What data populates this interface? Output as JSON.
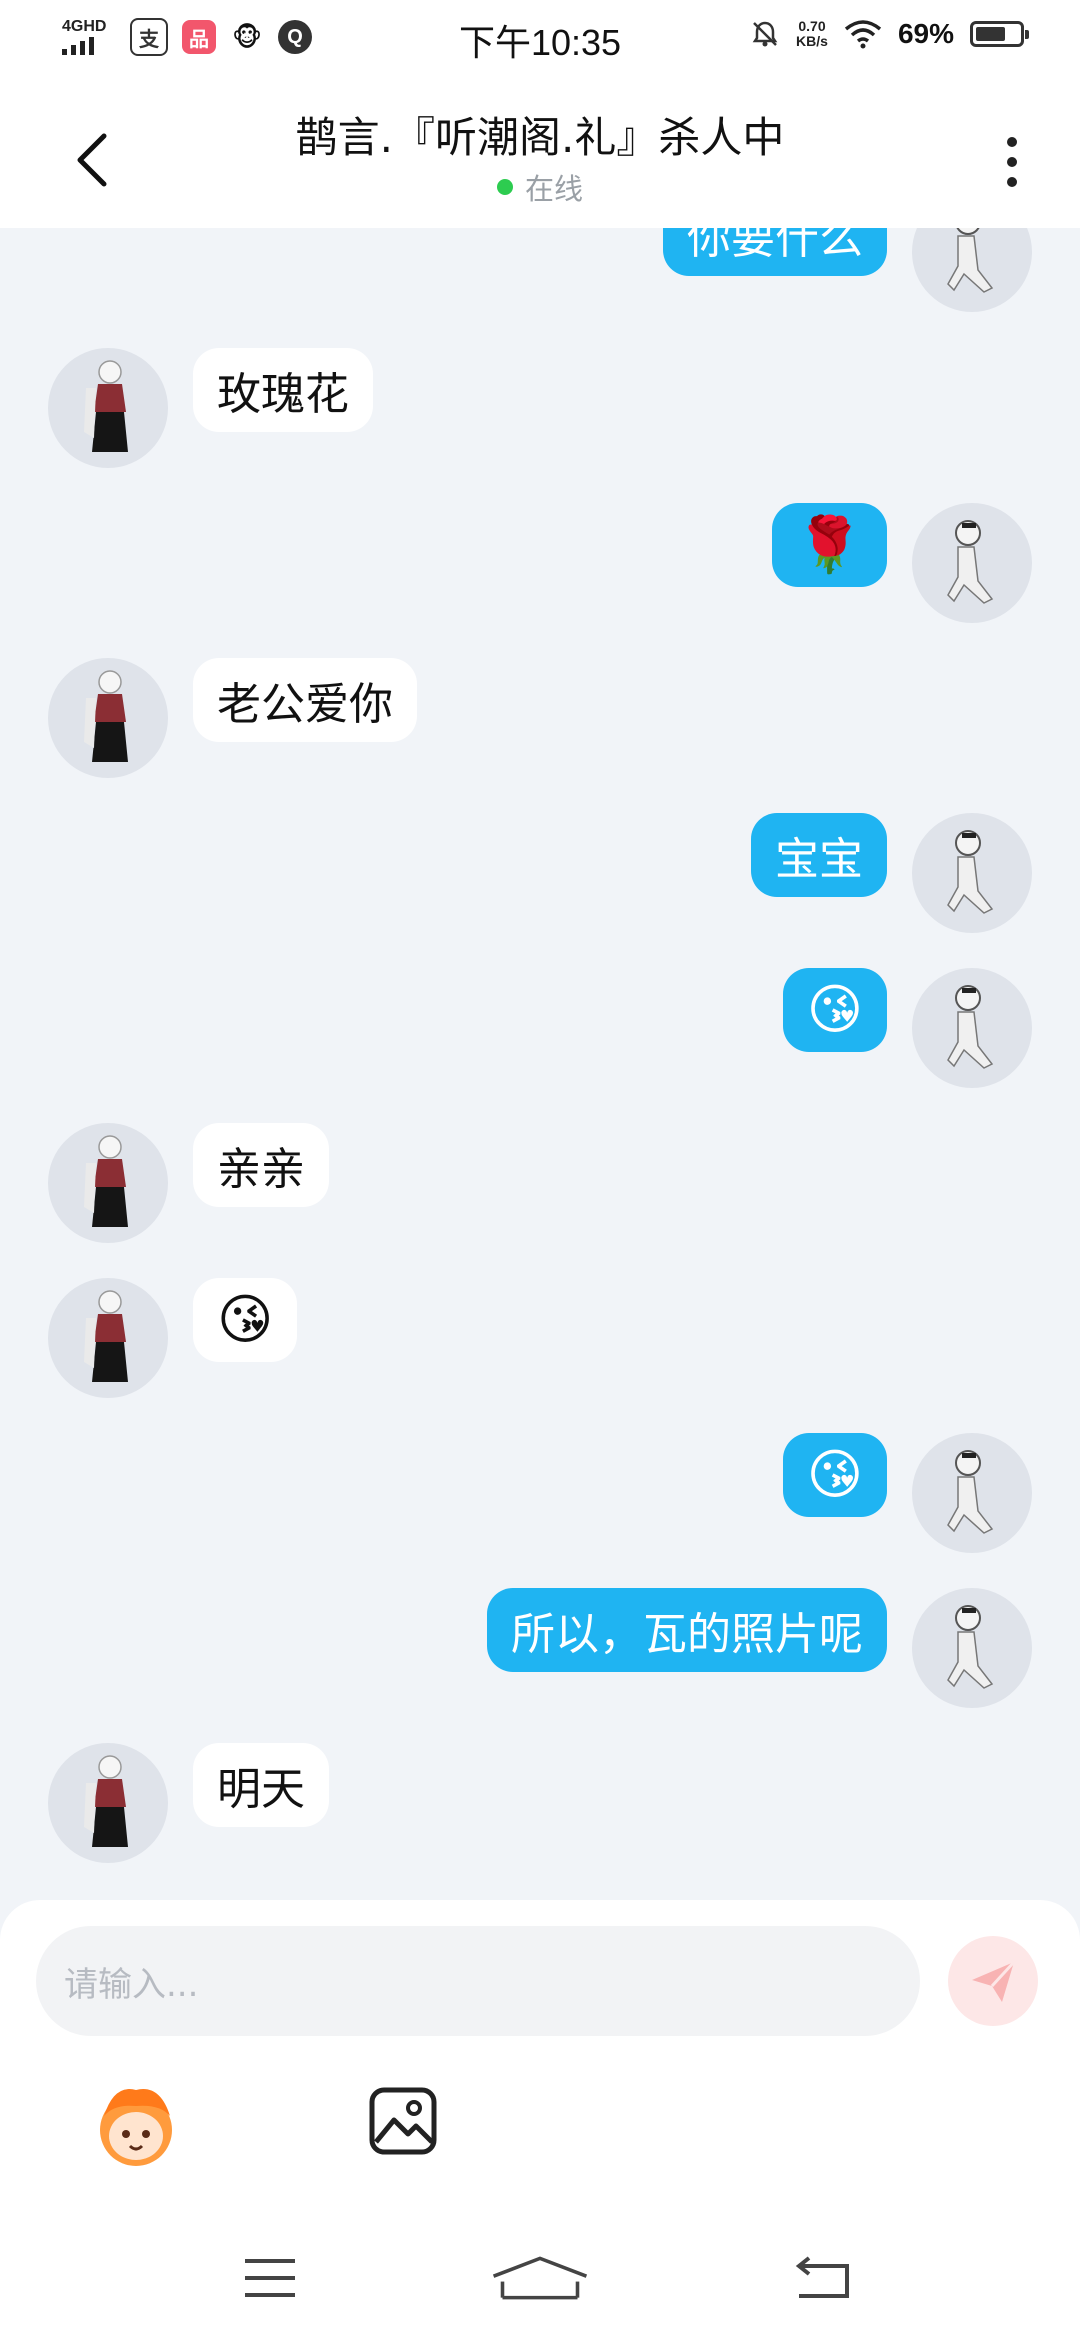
{
  "status_bar": {
    "network": "4GHD",
    "app_icons": [
      "支",
      "品",
      "🐵",
      "Q"
    ],
    "time": "下午10:35",
    "speed_value": "0.70",
    "speed_unit": "KB/s",
    "battery": "69%",
    "battery_level": 0.69
  },
  "header": {
    "title": "鹊言.『听潮阁.礼』杀人中",
    "status": "在线"
  },
  "messages": [
    {
      "side": "right",
      "text": "你要什么"
    },
    {
      "side": "left",
      "text": "玫瑰花"
    },
    {
      "side": "right",
      "text": "🌹"
    },
    {
      "side": "left",
      "text": "老公爱你"
    },
    {
      "side": "right",
      "text": "宝宝"
    },
    {
      "side": "right",
      "text": "😘"
    },
    {
      "side": "left",
      "text": "亲亲"
    },
    {
      "side": "left",
      "text": "😘"
    },
    {
      "side": "right",
      "text": "😘"
    },
    {
      "side": "right",
      "text": "所以，瓦的照片呢"
    },
    {
      "side": "left",
      "text": "明天"
    }
  ],
  "composer": {
    "placeholder": "请输入...",
    "icons": [
      "emoji-sticker-icon",
      "image-icon",
      "send-icon"
    ]
  },
  "nav_bar": {
    "icons": [
      "menu-icon",
      "home-icon",
      "back-nav-icon"
    ]
  },
  "colors": {
    "outgoing_bubble": "#1fb4f2",
    "incoming_bubble": "#ffffff",
    "background": "#f1f4f8",
    "online_dot": "#2dcc50"
  }
}
